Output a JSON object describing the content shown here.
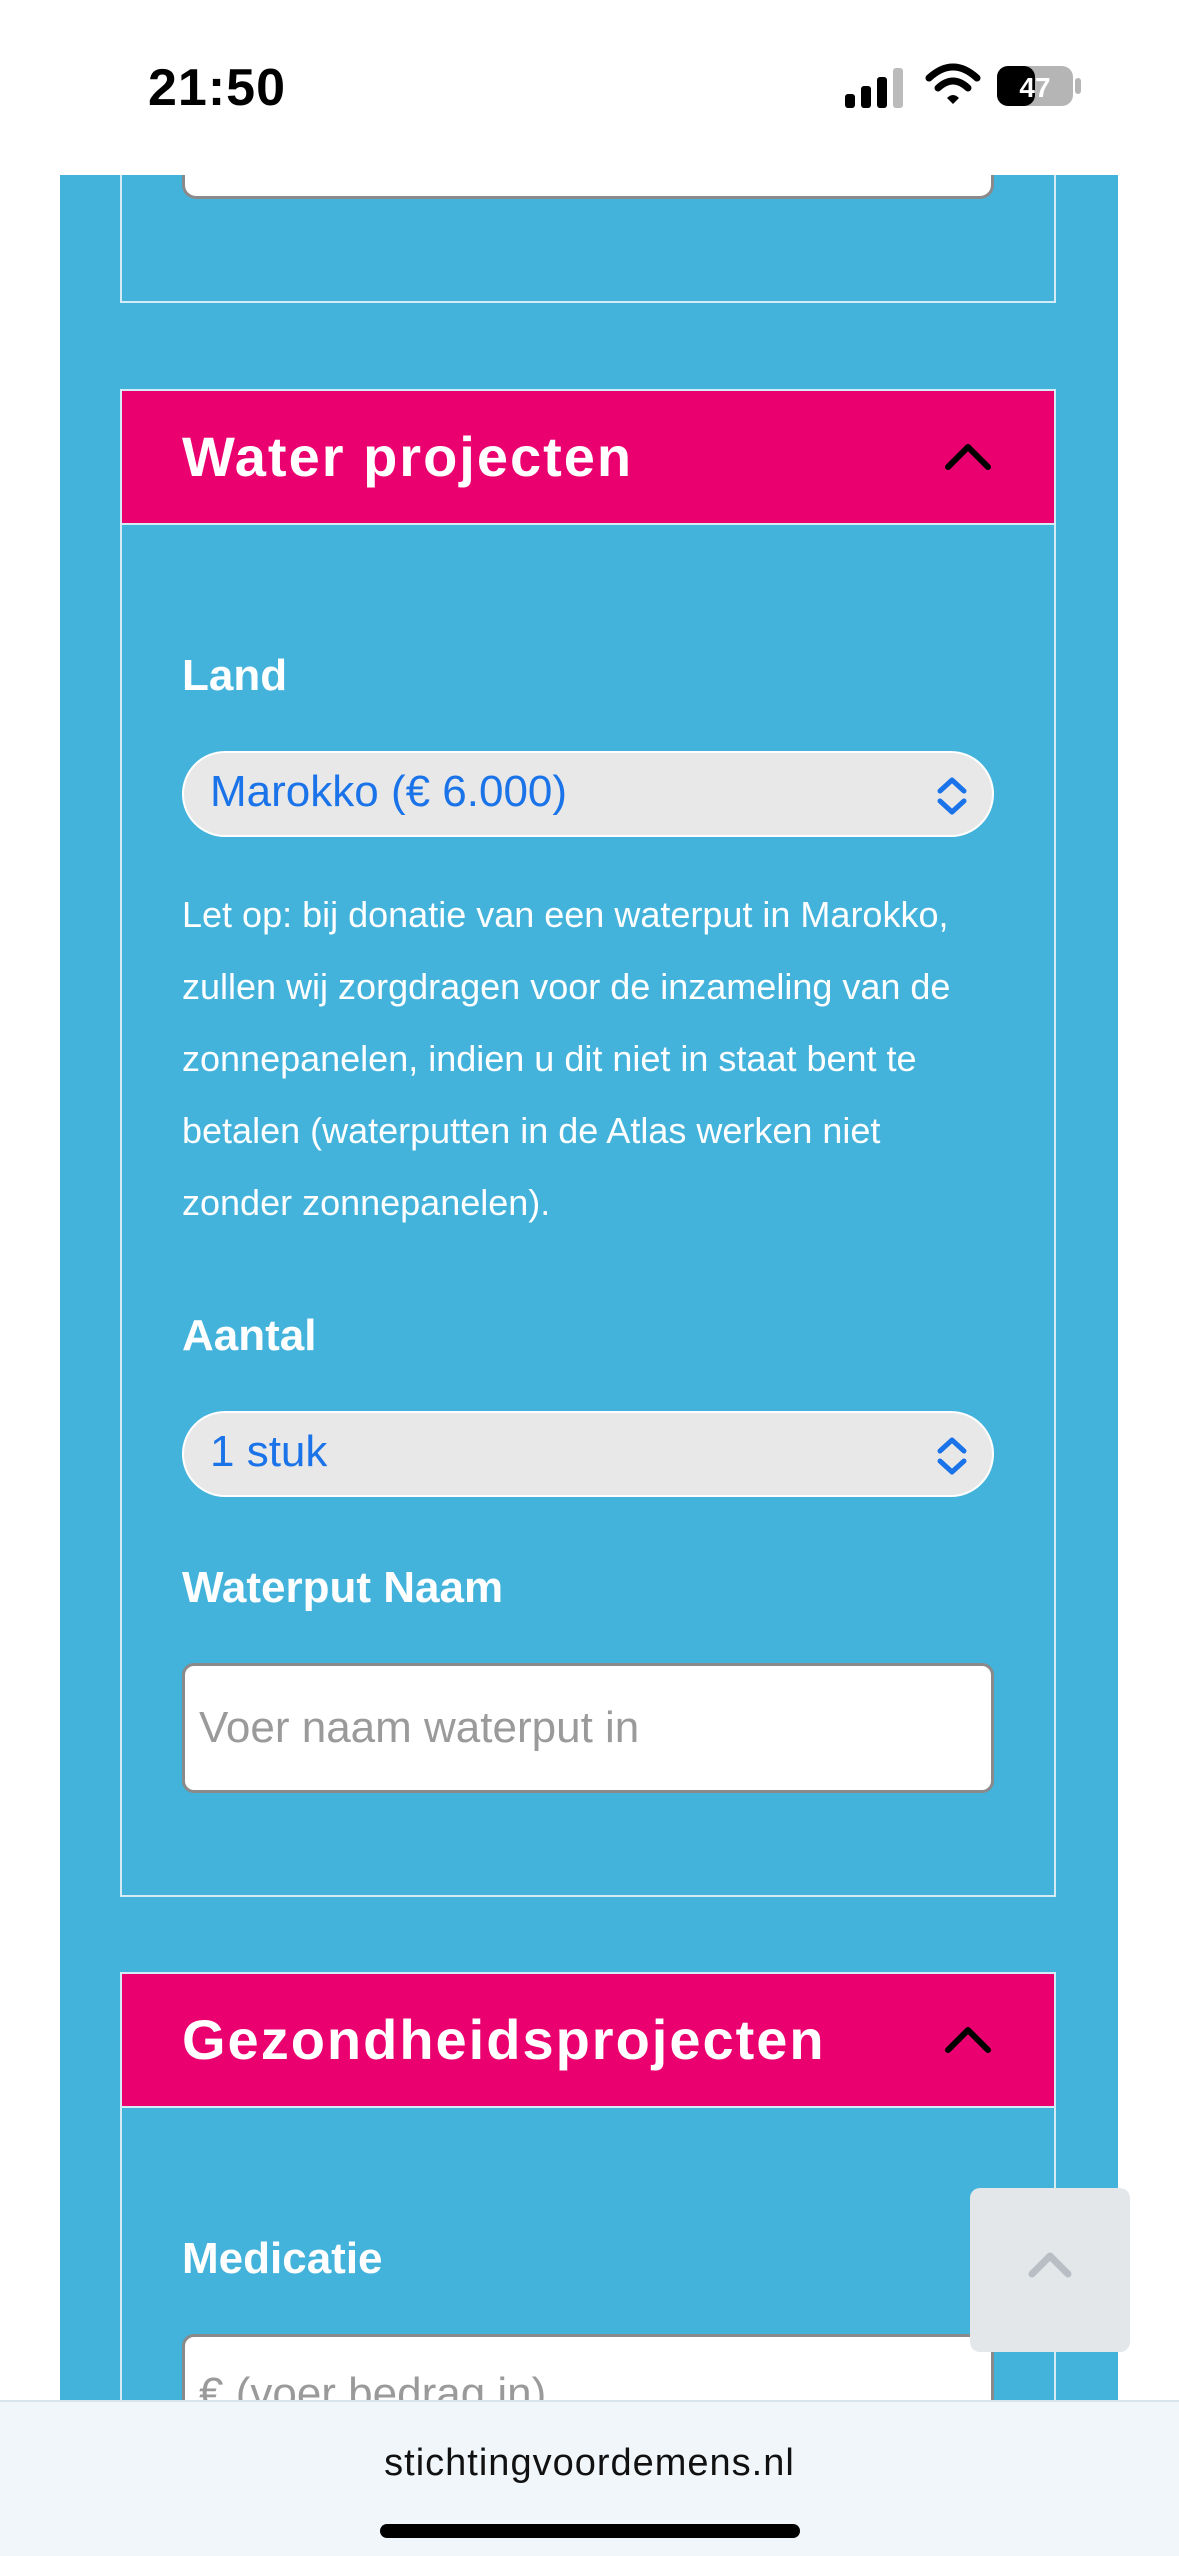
{
  "status_bar": {
    "time": "21:50",
    "battery": "47"
  },
  "sections": {
    "water": {
      "title": "Water projecten",
      "land_label": "Land",
      "land_value": "Marokko (€ 6.000)",
      "note": "Let op: bij donatie van een waterput in Marokko, zullen wij zorgdragen voor de inzameling van de zonnepanelen, indien u dit niet in staat bent te betalen (waterputten in de Atlas werken niet zonder zonnepanelen).",
      "aantal_label": "Aantal",
      "aantal_value": "1 stuk",
      "naam_label": "Waterput Naam",
      "naam_placeholder": "Voer naam waterput in"
    },
    "health": {
      "title": "Gezondheidsprojecten",
      "medicatie_label": "Medicatie",
      "medicatie_placeholder": "€ (voer bedrag in)"
    }
  },
  "browser": {
    "url": "stichtingvoordemens.nl"
  },
  "colors": {
    "page_blue": "#43b3dc",
    "header_pink": "#eb0070",
    "select_text": "#1a73e8"
  },
  "icons": [
    "signal-icon",
    "wifi-icon",
    "battery-icon",
    "chevron-up-icon",
    "select-arrows-icon",
    "scroll-top-icon"
  ]
}
